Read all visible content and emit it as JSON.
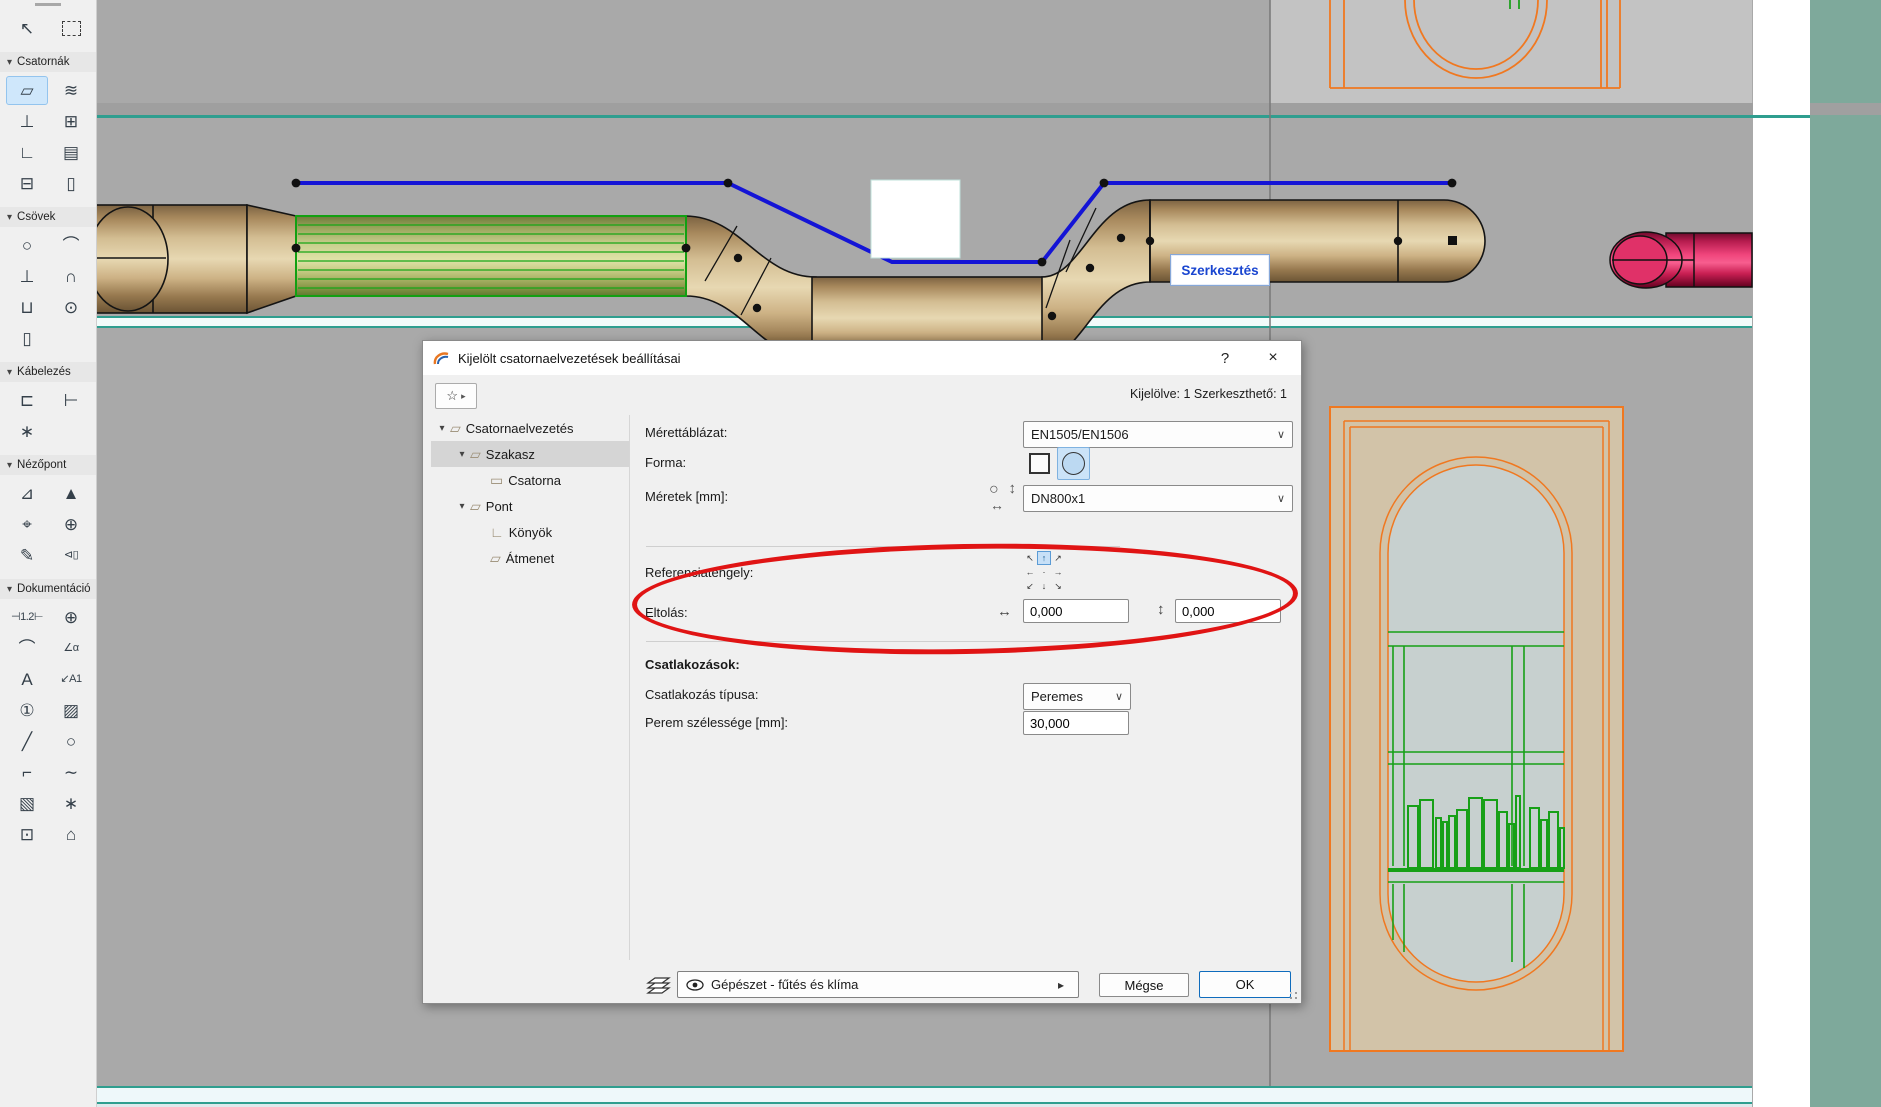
{
  "window": {
    "title": "Kijelölt csatornaelvezetések beállításai",
    "help_label": "?",
    "close_label": "×",
    "status": "Kijelölve: 1 Szerkeszthető: 1",
    "favorite_star": "☆",
    "favorite_arrow": "▸"
  },
  "glyphs": {
    "combo_chevron": "∨",
    "tree_chevron": "▾",
    "header_chevron": "▾",
    "layer_arrow": "▸",
    "size_icon_circle": "○",
    "size_icon_vertical": "↕",
    "size_icon_horizontal": "↔",
    "offset_x_icon": "↔",
    "offset_y_icon": "↕"
  },
  "toolbar": {
    "sections": [
      {
        "label": "",
        "items": [
          {
            "name": "arrow-tool",
            "glyph": "↖"
          },
          {
            "name": "marquee-tool",
            "glyph": "",
            "box": true
          }
        ]
      },
      {
        "label": "Csatornák",
        "items": [
          {
            "name": "duct-segment-tool",
            "glyph": "▱",
            "selected": true
          },
          {
            "name": "duct-flexible-tool",
            "glyph": "≋"
          },
          {
            "name": "duct-t-junction-tool",
            "glyph": "⊥"
          },
          {
            "name": "duct-takeoff-tool",
            "glyph": "⊞"
          },
          {
            "name": "duct-elbow-tool",
            "glyph": "∟"
          },
          {
            "name": "duct-louver-tool",
            "glyph": "▤"
          },
          {
            "name": "duct-junction-tool",
            "glyph": "⊟"
          },
          {
            "name": "duct-vertical-tool",
            "glyph": "▯"
          }
        ]
      },
      {
        "label": "Csövek",
        "items": [
          {
            "name": "pipe-segment-tool",
            "glyph": "○"
          },
          {
            "name": "pipe-bend-tool",
            "glyph": "⌒"
          },
          {
            "name": "pipe-t-junction-tool",
            "glyph": "⊥"
          },
          {
            "name": "pipe-elbow-tool",
            "glyph": "∩"
          },
          {
            "name": "pipe-drain-tool",
            "glyph": "⊔"
          },
          {
            "name": "pipe-tank-tool",
            "glyph": "⊙"
          },
          {
            "name": "pipe-vertical-tool",
            "glyph": "▯"
          }
        ]
      },
      {
        "label": "Kábelezés",
        "items": [
          {
            "name": "cable-tray-tool",
            "glyph": "⊏"
          },
          {
            "name": "cable-tray-t-tool",
            "glyph": "⊢"
          },
          {
            "name": "cable-flex-tool",
            "glyph": "∗"
          }
        ]
      },
      {
        "label": "Nézőpont",
        "items": [
          {
            "name": "section-tool",
            "glyph": "⊿"
          },
          {
            "name": "elevation-tool",
            "glyph": "▲"
          },
          {
            "name": "interior-elevation-tool",
            "glyph": "⌖"
          },
          {
            "name": "detail-tool",
            "glyph": "⊕"
          },
          {
            "name": "worksheet-tool",
            "glyph": "✎"
          },
          {
            "name": "camera-tool",
            "glyph": "⊲▯",
            "small": true
          }
        ]
      },
      {
        "label": "Dokumentáció",
        "items": [
          {
            "name": "dimension-tool",
            "glyph": "⊣1.2⊢",
            "small": true
          },
          {
            "name": "circular-dimension-tool",
            "glyph": "⊕"
          },
          {
            "name": "radial-dimension-tool",
            "glyph": "⌒"
          },
          {
            "name": "angle-dimension-tool",
            "glyph": "∠α",
            "small": true
          },
          {
            "name": "text-tool",
            "glyph": "A"
          },
          {
            "name": "label-tool",
            "glyph": "↙A1",
            "small": true
          },
          {
            "name": "zone-stamp-tool",
            "glyph": "①"
          },
          {
            "name": "fill-tool",
            "glyph": "▨"
          },
          {
            "name": "line-tool",
            "glyph": "╱"
          },
          {
            "name": "circle-tool",
            "glyph": "○"
          },
          {
            "name": "polyline-tool",
            "glyph": "⌐"
          },
          {
            "name": "spline-tool",
            "glyph": "∼"
          },
          {
            "name": "hatch-tool",
            "glyph": "▧"
          },
          {
            "name": "star-tool",
            "glyph": "∗"
          },
          {
            "name": "image-tool",
            "glyph": "⊡"
          },
          {
            "name": "object-tool",
            "glyph": "⌂"
          }
        ]
      }
    ]
  },
  "canvas": {
    "edit_label": "Szerkesztés"
  },
  "dialog": {
    "tree": {
      "items": [
        {
          "label": "Csatornaelvezetés",
          "level": 0,
          "chevron": true,
          "glyph": "▱"
        },
        {
          "label": "Szakasz",
          "level": 1,
          "chevron": true,
          "glyph": "▱",
          "selected": true
        },
        {
          "label": "Csatorna",
          "level": 2,
          "chevron": false,
          "glyph": "▭"
        },
        {
          "label": "Pont",
          "level": 1,
          "chevron": true,
          "glyph": "▱"
        },
        {
          "label": "Könyök",
          "level": 2,
          "chevron": false,
          "glyph": "∟"
        },
        {
          "label": "Átmenet",
          "level": 2,
          "chevron": false,
          "glyph": "▱"
        }
      ]
    },
    "fields": {
      "size_table_label": "Mérettáblázat:",
      "size_table_value": "EN1505/EN1506",
      "shape_label": "Forma:",
      "sizes_label": "Méretek [mm]:",
      "sizes_value": "DN800x1",
      "reference_axis_label": "Referenciatengely:",
      "offset_label": "Eltolás:",
      "offset_x": "0,000",
      "offset_y": "0,000",
      "connections_label": "Csatlakozások:",
      "connection_type_label": "Csatlakozás típusa:",
      "connection_type_value": "Peremes",
      "flange_width_label": "Perem szélessége [mm]:",
      "flange_width_value": "30,000"
    },
    "anchor": {
      "cells": [
        "↖",
        "↑",
        "↗",
        "←",
        "·",
        "→",
        "↙",
        "↓",
        "↘"
      ],
      "selected_index": 1
    },
    "footer": {
      "layer": "Gépészet - fűtés és klíma",
      "cancel": "Mégse",
      "ok": "OK"
    }
  },
  "colors": {
    "accent_blue": "#0f6cbd",
    "selection_green": "#17a617",
    "route_blue": "#1414d6",
    "annotation_red": "#e01414",
    "teal_line": "#2f9e8f",
    "duct_tan": "#d8c49c",
    "pipe_pink": "#f0457c",
    "door_orange": "#f07820"
  }
}
